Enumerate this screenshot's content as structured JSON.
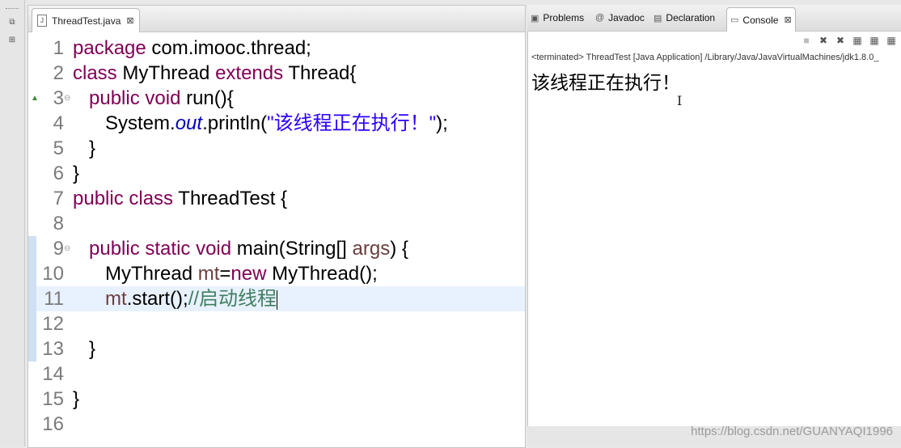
{
  "editor": {
    "tab": {
      "label": "ThreadTest.java",
      "close": "⊠"
    },
    "lines": [
      {
        "n": "1",
        "html": "<span class=\"kw\">package</span> com.imooc.thread;"
      },
      {
        "n": "2",
        "html": "<span class=\"kw\">class</span> MyThread <span class=\"kw\">extends</span> Thread{"
      },
      {
        "n": "3",
        "html": "   <span class=\"kw\">public void</span> run(){"
      },
      {
        "n": "4",
        "html": "      System.<span class=\"fld\">out</span>.println(<span class=\"str\">\"该线程正在执行！\"</span>);"
      },
      {
        "n": "5",
        "html": "   }"
      },
      {
        "n": "6",
        "html": "}"
      },
      {
        "n": "7",
        "html": "<span class=\"kw\">public class</span> ThreadTest {"
      },
      {
        "n": "8",
        "html": ""
      },
      {
        "n": "9",
        "html": "   <span class=\"kw\">public static void</span> main(String[] <span class=\"var\">args</span>) {"
      },
      {
        "n": "10",
        "html": "      MyThread <span class=\"var\">mt</span>=<span class=\"kw\">new</span> MyThread();"
      },
      {
        "n": "11",
        "html": "      <span class=\"var\">mt</span>.start();<span class=\"cm\">//启动线程</span><span class=\"caret\"></span>"
      },
      {
        "n": "12",
        "html": ""
      },
      {
        "n": "13",
        "html": "   }"
      },
      {
        "n": "14",
        "html": ""
      },
      {
        "n": "15",
        "html": "}"
      },
      {
        "n": "16",
        "html": ""
      }
    ],
    "current_line": 11,
    "fold_lines": [
      3,
      9
    ],
    "override_line": 3,
    "gutter_mark_lines": [
      9,
      10,
      11,
      12,
      13
    ]
  },
  "views": {
    "tabs": [
      {
        "label": "Problems",
        "icon": "▣"
      },
      {
        "label": "Javadoc",
        "icon": "@"
      },
      {
        "label": "Declaration",
        "icon": "▤"
      },
      {
        "label": "Console",
        "icon": "▭",
        "active": true,
        "close": "⊠"
      }
    ]
  },
  "console": {
    "terminated_label": "<terminated> ThreadTest [Java Application] /Library/Java/JavaVirtualMachines/jdk1.8.0_",
    "output": "该线程正在执行！",
    "toolbar_icons": [
      "■",
      "✖",
      "✖",
      "▦",
      "▦",
      "▦"
    ]
  },
  "watermark": "https://blog.csdn.net/GUANYAQI1996",
  "colors": {
    "keyword": "#7f0055",
    "string": "#2a00ff",
    "comment": "#3f7f5f",
    "field": "#0000c0",
    "current_line": "#e8f2fe"
  }
}
